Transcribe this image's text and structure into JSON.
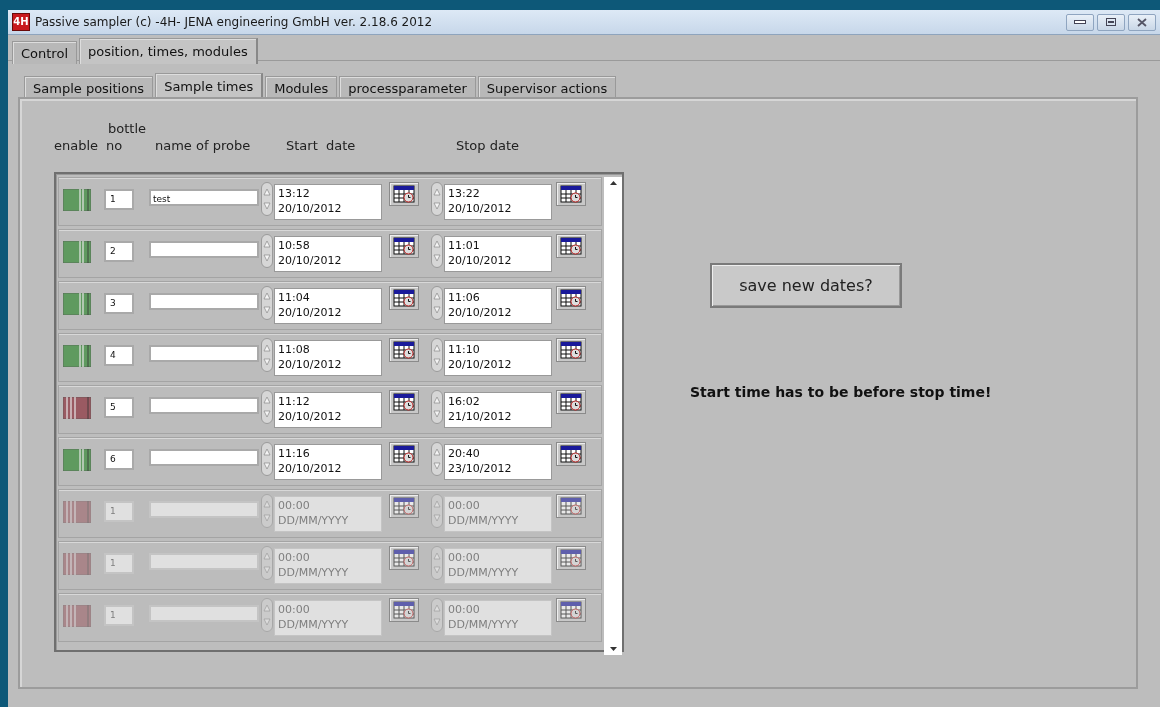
{
  "window": {
    "logo_text": "4H",
    "title": "Passive sampler (c) -4H- JENA engineering GmbH ver. 2.18.6  2012"
  },
  "outer_tabs": [
    {
      "label": "Control",
      "selected": false
    },
    {
      "label": "position, times, modules",
      "selected": true
    }
  ],
  "inner_tabs": [
    {
      "label": "Sample positions",
      "selected": false
    },
    {
      "label": "Sample times",
      "selected": true
    },
    {
      "label": "Modules",
      "selected": false
    },
    {
      "label": "processparameter",
      "selected": false
    },
    {
      "label": "Supervisor actions",
      "selected": false
    }
  ],
  "columns": {
    "enable": "enable",
    "bottle": "bottle",
    "no": "no",
    "name": "name of probe",
    "start": "Start  date",
    "stop": "Stop date"
  },
  "rows": [
    {
      "enabled": true,
      "disabled": false,
      "no": "1",
      "name": "test",
      "start_time": "13:12",
      "start_date": "20/10/2012",
      "stop_time": "13:22",
      "stop_date": "20/10/2012"
    },
    {
      "enabled": true,
      "disabled": false,
      "no": "2",
      "start_time": "10:58",
      "start_date": "20/10/2012",
      "stop_time": "11:01",
      "stop_date": "20/10/2012"
    },
    {
      "enabled": true,
      "disabled": false,
      "no": "3",
      "start_time": "11:04",
      "start_date": "20/10/2012",
      "stop_time": "11:06",
      "stop_date": "20/10/2012"
    },
    {
      "enabled": true,
      "disabled": false,
      "no": "4",
      "start_time": "11:08",
      "start_date": "20/10/2012",
      "stop_time": "11:10",
      "stop_date": "20/10/2012"
    },
    {
      "enabled": false,
      "disabled": false,
      "no": "5",
      "start_time": "11:12",
      "start_date": "20/10/2012",
      "stop_time": "16:02",
      "stop_date": "21/10/2012"
    },
    {
      "enabled": true,
      "disabled": false,
      "no": "6",
      "start_time": "11:16",
      "start_date": "20/10/2012",
      "stop_time": "20:40",
      "stop_date": "23/10/2012"
    },
    {
      "enabled": false,
      "disabled": true,
      "no": "1",
      "start_time": "00:00",
      "start_date": "DD/MM/YYYY",
      "stop_time": "00:00",
      "stop_date": "DD/MM/YYYY"
    },
    {
      "enabled": false,
      "disabled": true,
      "no": "1",
      "start_time": "00:00",
      "start_date": "DD/MM/YYYY",
      "stop_time": "00:00",
      "stop_date": "DD/MM/YYYY"
    },
    {
      "enabled": false,
      "disabled": true,
      "no": "1",
      "start_time": "00:00",
      "start_date": "DD/MM/YYYY",
      "stop_time": "00:00",
      "stop_date": "DD/MM/YYYY"
    }
  ],
  "save_button": "save new dates?",
  "message": "Start time has to be before stop time!"
}
